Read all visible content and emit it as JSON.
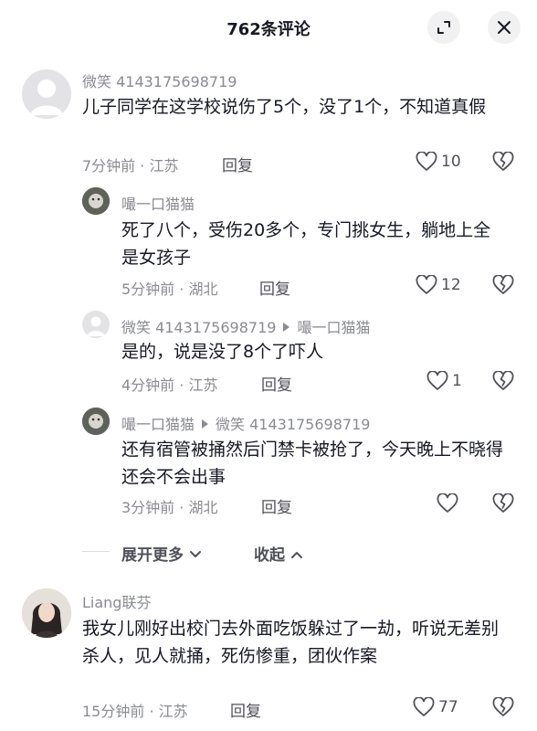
{
  "header": {
    "title": "762条评论"
  },
  "comments": [
    {
      "username": "微笑 4143175698719",
      "text": "儿子同学在这学校说伤了5个，没了1个，不知道真假",
      "meta": "7分钟前 · 江苏",
      "reply_label": "回复",
      "likes": "10"
    },
    {
      "username": "嘬一口猫猫",
      "text": "死了八个，受伤20多个，专门挑女生，躺地上全是女孩子",
      "meta": "5分钟前 · 湖北",
      "reply_label": "回复",
      "likes": "12"
    },
    {
      "username": "微笑 4143175698719",
      "reply_to": "嘬一口猫猫",
      "text": "是的，说是没了8个了吓人",
      "meta": "4分钟前 · 江苏",
      "reply_label": "回复",
      "likes": "1"
    },
    {
      "username": "嘬一口猫猫",
      "reply_to": "微笑 4143175698719",
      "text": "还有宿管被捅然后门禁卡被抢了，今天晚上不晓得还会不会出事",
      "meta": "3分钟前 · 湖北",
      "reply_label": "回复",
      "likes": ""
    },
    {
      "username": "Liang联芬",
      "text": "我女儿刚好出校门去外面吃饭躲过了一劫，听说无差别杀人，见人就捅，死伤惨重，团伙作案",
      "meta": "15分钟前 · 江苏",
      "reply_label": "回复",
      "likes": "77"
    }
  ],
  "thread_controls": {
    "expand_label": "展开更多",
    "collapse_label": "收起"
  },
  "colors": {
    "text": "#161823",
    "secondary": "#8a8b91",
    "action": "#505158",
    "button_bg": "#f1f1f2"
  }
}
